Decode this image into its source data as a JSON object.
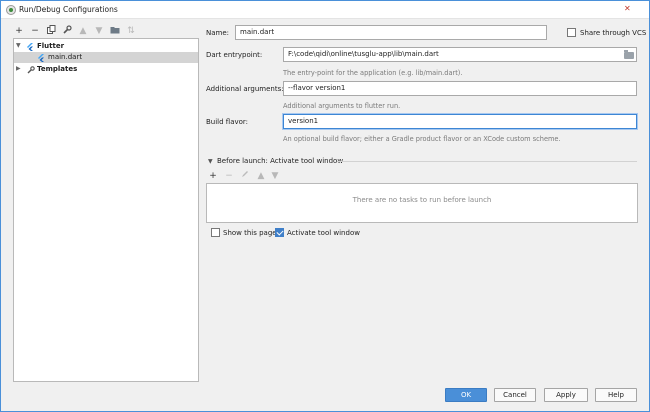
{
  "window": {
    "title": "Run/Debug Configurations",
    "close_glyph": "✕"
  },
  "toolbar": {
    "add": "+",
    "remove": "−",
    "copy": "⧉",
    "edit": "🔧",
    "up": "▲",
    "down": "▼",
    "folder": "▤",
    "sort": "⇅"
  },
  "tree": {
    "items": [
      {
        "label": "Flutter",
        "expanded": true,
        "bold": true
      },
      {
        "label": "main.dart",
        "selected": true
      },
      {
        "label": "Templates",
        "expanded": false,
        "bold": true
      }
    ]
  },
  "form": {
    "name_label": "Name:",
    "name_value": "main.dart",
    "share_label": "Share through VCS",
    "entrypoint_label": "Dart entrypoint:",
    "entrypoint_value": "F:\\code\\qidi\\online\\tusglu-app\\lib\\main.dart",
    "entrypoint_hint": "The entry-point for the application (e.g. lib/main.dart).",
    "args_label": "Additional arguments:",
    "args_value": "--flavor version1",
    "args_hint": "Additional arguments to flutter run.",
    "flavor_label": "Build flavor:",
    "flavor_value": "version1",
    "flavor_hint": "An optional build flavor; either a Gradle product flavor or an XCode custom scheme."
  },
  "before_launch": {
    "header": "Before launch: Activate tool window",
    "empty_text": "There are no tasks to run before launch",
    "show_page_label": "Show this page",
    "show_page_checked": false,
    "activate_label": "Activate tool window",
    "activate_checked": true
  },
  "buttons": {
    "ok": "OK",
    "cancel": "Cancel",
    "apply": "Apply",
    "help": "Help"
  },
  "colors": {
    "accent": "#4a8fd8",
    "selection": "#d4d4d4",
    "flutter": "#42a5f5"
  }
}
